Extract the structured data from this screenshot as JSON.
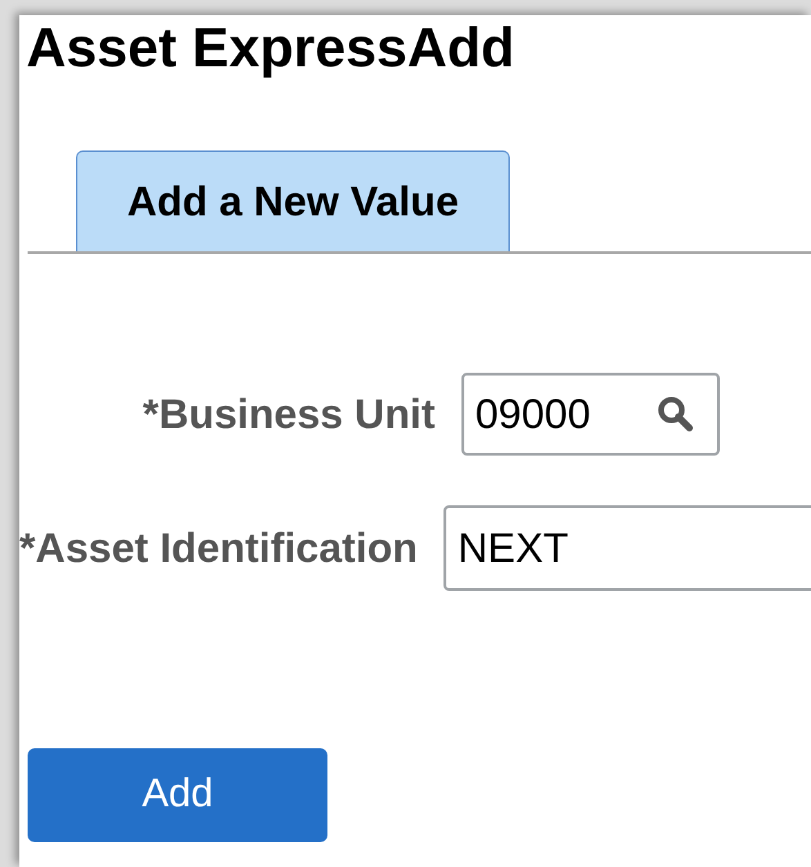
{
  "page_title": "Asset ExpressAdd",
  "tabs": [
    {
      "label": "Add a New Value",
      "selected": true
    }
  ],
  "fields": [
    {
      "label": "*Business Unit",
      "value": "09000",
      "lookup": true
    },
    {
      "label": "*Asset Identification",
      "value": "NEXT",
      "lookup": false
    }
  ],
  "buttons": [
    "Add"
  ]
}
